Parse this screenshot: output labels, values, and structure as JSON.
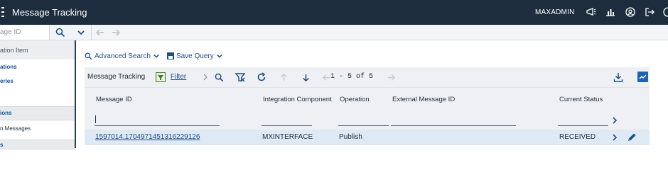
{
  "topbar": {
    "title": "Message Tracking",
    "user": "MAXADMIN",
    "icons": [
      "menu-icon",
      "announcement-icon",
      "chart-icon",
      "user-profile-icon",
      "logout-icon",
      "help-icon"
    ]
  },
  "search": {
    "placeholder": "age ID"
  },
  "leftnav": {
    "items": [
      {
        "label": "ation Item",
        "kind": "header"
      },
      {
        "label": "ations",
        "kind": "link"
      },
      {
        "label": "eries",
        "kind": "link"
      },
      {
        "label": "ions",
        "kind": "section"
      },
      {
        "label": "n Messages",
        "kind": "plain"
      },
      {
        "label": "s",
        "kind": "section"
      }
    ]
  },
  "main": {
    "advanced_search_label": "Advanced Search",
    "save_query_label": "Save Query"
  },
  "table": {
    "title": "Message Tracking",
    "filter_label": "Filter",
    "range_label": "1 - 5 of 5",
    "columns": [
      "Message ID",
      "Integration Component",
      "Operation",
      "External Message ID",
      "Current Status"
    ],
    "rows": [
      {
        "message_id": "1597014.1704971451316229126",
        "integration_component": "MXINTERFACE",
        "operation": "Publish",
        "external_message_id": "",
        "current_status": "RECEIVED"
      }
    ]
  },
  "colors": {
    "topbar_bg": "#1e2d3d",
    "accent": "#1b4f8a",
    "row_selected": "#dfe9f5",
    "toolbar_bg": "#eef0f3"
  }
}
